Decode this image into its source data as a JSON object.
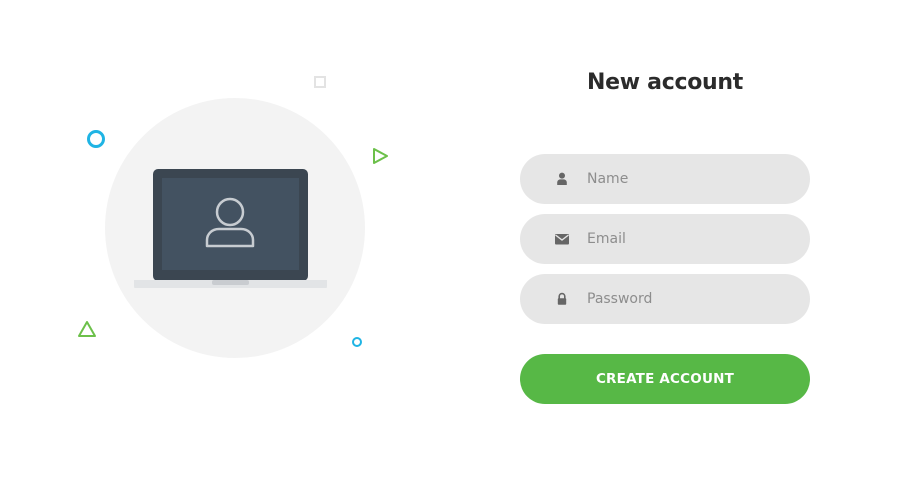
{
  "form": {
    "title": "New account",
    "fields": {
      "name": {
        "placeholder": "Name",
        "value": "",
        "icon": "user-icon"
      },
      "email": {
        "placeholder": "Email",
        "value": "",
        "icon": "envelope-icon"
      },
      "password": {
        "placeholder": "Password",
        "value": "",
        "icon": "lock-icon"
      }
    },
    "submit_label": "CREATE ACCOUNT"
  },
  "illustration": {
    "icon": "laptop-user-icon",
    "decorations": [
      "ring-icon",
      "square-icon",
      "triangle-icon"
    ]
  },
  "colors": {
    "accent_green": "#57b846",
    "accent_blue": "#1fb4e4",
    "field_bg": "#e6e6e6",
    "title": "#2b2b2b",
    "placeholder": "#8d8d8d",
    "laptop_dark": "#3b4651",
    "laptop_screen": "#435261"
  }
}
